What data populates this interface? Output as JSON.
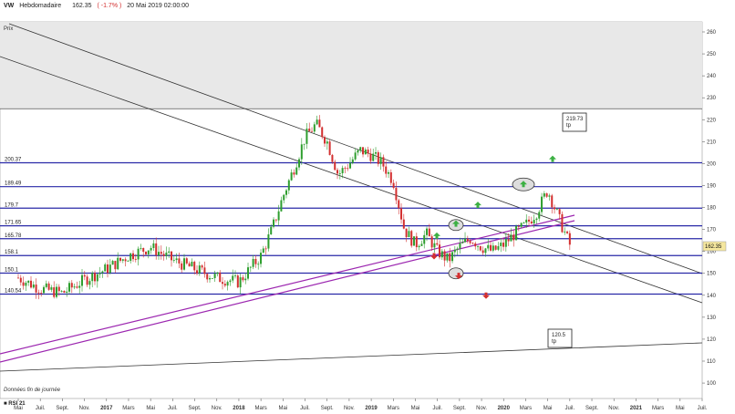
{
  "header": {
    "symbol": "VW",
    "period": "Hebdomadaire",
    "price": "162.35",
    "change": "( -1.7% )",
    "date": "20 Mai 2019 02:00:00"
  },
  "panel_label": "Prix",
  "footer_text": "Données fin de journée",
  "rsi_label": "RSI 21",
  "colors": {
    "support_resistance": "#2a2aa8",
    "trend_channel": "#9c27b0",
    "trendline": "#333333",
    "up_candle": "#2e9e2e",
    "down_candle": "#d32f2f",
    "arrow_up": "#3cb043",
    "arrow_down": "#d32f2f",
    "shaded_zone": "#e8e8e8",
    "price_marker": "#f5e79e"
  },
  "chart_data": {
    "type": "candlestick",
    "title": "VW Hebdomadaire",
    "ylim": [
      100,
      265
    ],
    "y_ticks": [
      "100",
      "110",
      "120",
      "130",
      "140",
      "150",
      "160",
      "170",
      "180",
      "190",
      "200",
      "210",
      "220",
      "230",
      "240",
      "250",
      "260"
    ],
    "x_tick_labels": [
      "Mai",
      "Juil.",
      "Sept.",
      "Nov.",
      "2017",
      "Mars",
      "Mai",
      "Juil.",
      "Sept.",
      "Nov.",
      "2018",
      "Mars",
      "Mai",
      "Juil.",
      "Sept.",
      "Nov.",
      "2019",
      "Mars",
      "Mai",
      "Juil.",
      "Sept.",
      "Nov.",
      "2020",
      "Mars",
      "Mai",
      "Juil.",
      "Sept.",
      "Nov.",
      "2021",
      "Mars",
      "Mai",
      "Juil."
    ],
    "last_price": "162.35",
    "horizontal_levels": [
      {
        "value": 200.37,
        "label": "200.37"
      },
      {
        "value": 189.49,
        "label": "189.49"
      },
      {
        "value": 179.7,
        "label": "179.7"
      },
      {
        "value": 171.65,
        "label": "171.65"
      },
      {
        "value": 165.78,
        "label": "165.78"
      },
      {
        "value": 158.1,
        "label": "158.1"
      },
      {
        "value": 150.1,
        "label": "150.1"
      },
      {
        "value": 140.54,
        "label": "140.54"
      }
    ],
    "targets": [
      {
        "value": 219.73,
        "label": "219.73",
        "sub": "tp"
      },
      {
        "value": 120.5,
        "label": "120.5",
        "sub": "tp"
      }
    ],
    "shaded_zone": [
      225,
      265
    ]
  }
}
